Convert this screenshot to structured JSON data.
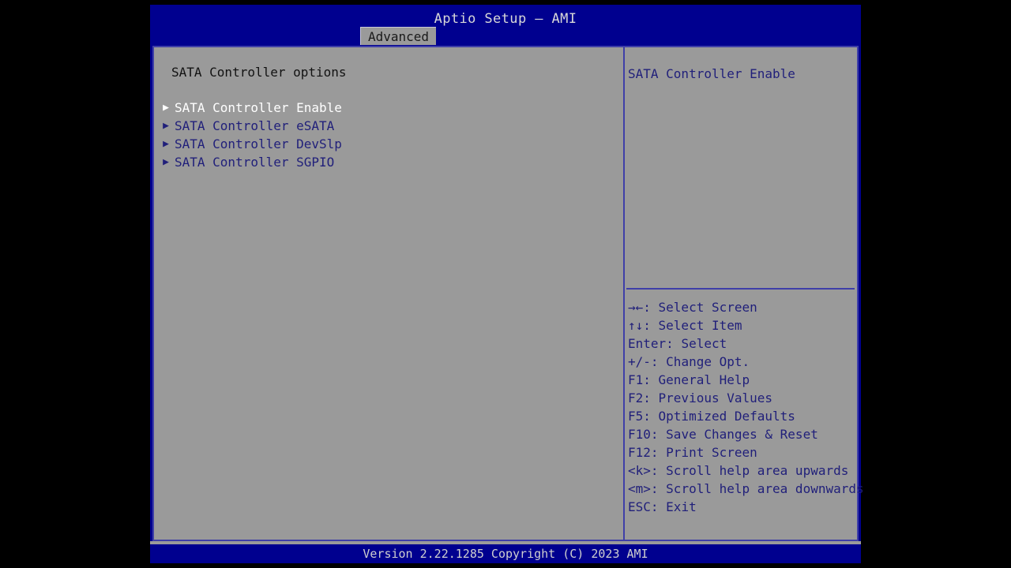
{
  "colors": {
    "header_blue": "#00008f",
    "panel_gray": "#9a9a9a",
    "border_blue": "#3f3fa8",
    "text_blue": "#201f7a",
    "selected_white": "#ffffff",
    "title_text": "#d8d8d8",
    "letterbox_black": "#000000"
  },
  "titlebar": {
    "app_title": "Aptio Setup – AMI"
  },
  "tabs": [
    {
      "label": "Advanced",
      "active": true
    }
  ],
  "left_pane": {
    "heading": "SATA Controller options",
    "items": [
      {
        "label": "SATA Controller Enable",
        "arrow": "submenu-arrow-icon",
        "selected": true
      },
      {
        "label": "SATA Controller eSATA",
        "arrow": "submenu-arrow-icon",
        "selected": false
      },
      {
        "label": "SATA Controller DevSlp",
        "arrow": "submenu-arrow-icon",
        "selected": false
      },
      {
        "label": "SATA Controller SGPIO",
        "arrow": "submenu-arrow-icon",
        "selected": false
      }
    ]
  },
  "right_pane": {
    "help_text": "SATA Controller Enable",
    "shortcuts": [
      {
        "key": "→←",
        "text": ": Select Screen"
      },
      {
        "key": "↑↓",
        "text": ": Select Item"
      },
      {
        "key": "Enter",
        "text": ": Select"
      },
      {
        "key": "+/-",
        "text": ": Change Opt."
      },
      {
        "key": "F1",
        "text": ": General Help"
      },
      {
        "key": "F2",
        "text": ": Previous Values"
      },
      {
        "key": "F5",
        "text": ": Optimized Defaults"
      },
      {
        "key": "F10",
        "text": ": Save Changes & Reset"
      },
      {
        "key": "F12",
        "text": ": Print Screen"
      },
      {
        "key": "<k>",
        "text": ": Scroll help area upwards"
      },
      {
        "key": "<m>",
        "text": ": Scroll help area downwards"
      },
      {
        "key": "ESC",
        "text": ": Exit"
      }
    ]
  },
  "statusbar": {
    "version_text": "Version 2.22.1285 Copyright (C) 2023 AMI"
  }
}
